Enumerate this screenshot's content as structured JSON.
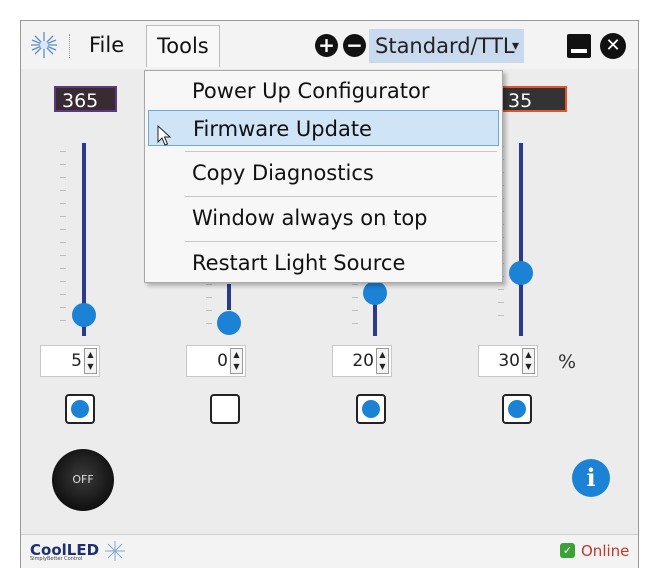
{
  "menu": {
    "file": "File",
    "tools": "Tools"
  },
  "toolbar": {
    "plus_symbol": "+",
    "minus_symbol": "−",
    "mode_value": "Standard/TTL",
    "caret": "▾",
    "close_symbol": "✕"
  },
  "channels": [
    {
      "wavelength": "365",
      "intensity": "5",
      "level_percent": 5,
      "enabled": true
    },
    {
      "wavelength": "",
      "intensity": "0",
      "level_percent": 0,
      "enabled": false
    },
    {
      "wavelength": "",
      "intensity": "20",
      "level_percent": 20,
      "enabled": true
    },
    {
      "wavelength": "35",
      "intensity": "30",
      "level_percent": 30,
      "enabled": true
    }
  ],
  "unit": "%",
  "controls": {
    "off_label": "OFF",
    "info_symbol": "i"
  },
  "status": {
    "brand": "CoolLED",
    "tagline": "SimplyBetter Control",
    "online": "Online",
    "online_symbol": "✓"
  },
  "tools_menu": {
    "items": [
      "Power Up Configurator",
      "Firmware Update",
      "Copy Diagnostics",
      "Window always on top",
      "Restart Light Source"
    ],
    "highlighted": "Firmware Update"
  },
  "colors": {
    "accent": "#1c82d6",
    "mode_bg": "#c9d9ee",
    "online": "#3aa238",
    "online_text": "#c0392b",
    "wl1_border": "#5a3a7a",
    "wl4_border": "#e0532c"
  },
  "icons": {
    "logo": "coolled-starburst-icon",
    "cursor": "mouse-pointer-icon"
  }
}
